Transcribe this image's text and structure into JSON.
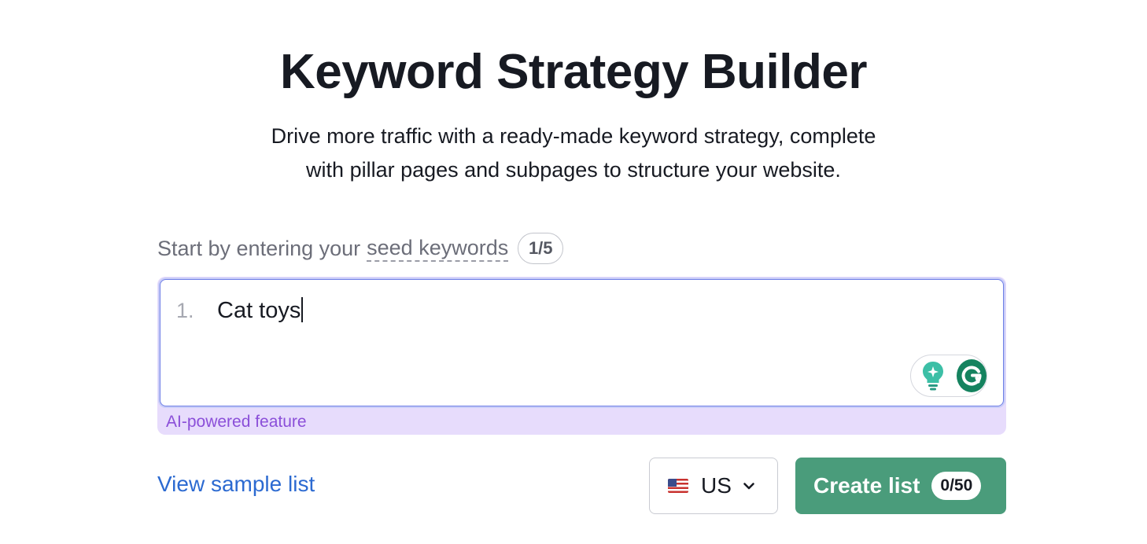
{
  "header": {
    "title": "Keyword Strategy Builder",
    "subtitle_line1": "Drive more traffic with a ready-made keyword strategy, complete",
    "subtitle_line2": "with pillar pages and subpages to structure your website."
  },
  "seed_prompt": {
    "text": "Start by entering your",
    "term": "seed keywords",
    "counter": "1/5"
  },
  "keyword_input": {
    "line_number": "1.",
    "value": "Cat toys"
  },
  "ai_label": "AI-powered feature",
  "footer": {
    "sample_link": "View sample list",
    "country": {
      "code": "US",
      "flag_icon": "us-flag-icon"
    },
    "create_button": {
      "label": "Create list",
      "count": "0/50"
    }
  },
  "colors": {
    "primary_button": "#4a9c7b",
    "link": "#2c6ad1",
    "ai_accent": "#8b4fd9",
    "ai_background": "#e7dcfc",
    "input_focus": "#6f7fe6"
  }
}
